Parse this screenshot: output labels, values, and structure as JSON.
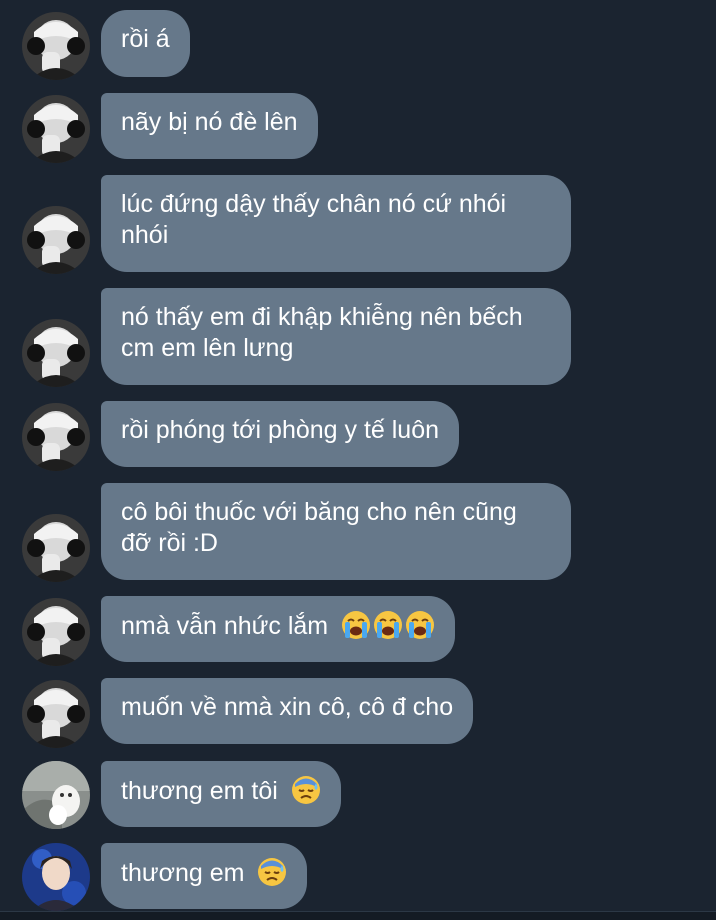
{
  "colors": {
    "background": "#1b2430",
    "bubble": "#66788a",
    "text": "#ffffff"
  },
  "messages": [
    {
      "text": "rồi á",
      "emojis": [],
      "avatar": "bw-headphones"
    },
    {
      "text": "nãy bị nó đè lên",
      "emojis": [],
      "avatar": "bw-headphones"
    },
    {
      "text": "lúc đứng dậy thấy chân nó cứ nhói nhói",
      "emojis": [],
      "avatar": "bw-headphones"
    },
    {
      "text": "nó thấy em đi khập khiễng nên bếch cm em lên lưng",
      "emojis": [],
      "avatar": "bw-headphones"
    },
    {
      "text": "rồi phóng tới phòng y tế luôn",
      "emojis": [],
      "avatar": "bw-headphones"
    },
    {
      "text": "cô bôi thuốc với băng cho nên cũng đỡ rồi :D",
      "emojis": [],
      "avatar": "bw-headphones"
    },
    {
      "text": "nmà vẫn nhức lắm",
      "emojis": [
        "loudly-crying-face",
        "loudly-crying-face",
        "loudly-crying-face"
      ],
      "avatar": "bw-headphones"
    },
    {
      "text": "muốn về nmà xin cô, cô đ cho",
      "emojis": [],
      "avatar": "bw-headphones"
    },
    {
      "text": "thương em tôi",
      "emojis": [
        "downcast-face-with-sweat"
      ],
      "avatar": "cat-paw"
    },
    {
      "text": "thương em",
      "emojis": [
        "downcast-face-with-sweat"
      ],
      "avatar": "blue-portrait"
    }
  ]
}
